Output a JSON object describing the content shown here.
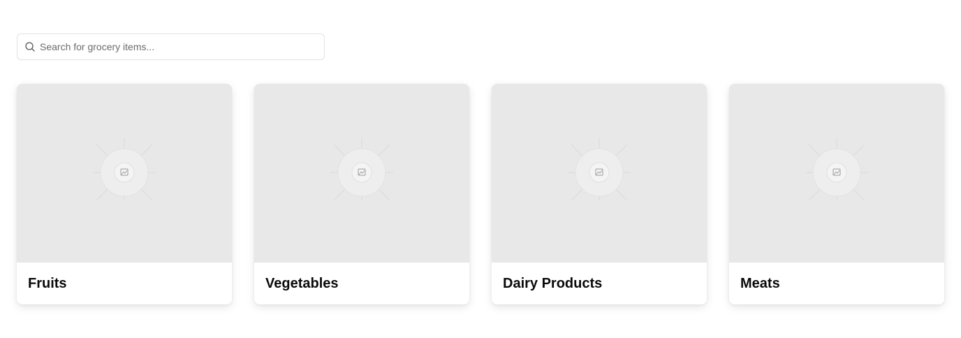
{
  "search": {
    "placeholder": "Search for grocery items..."
  },
  "categories": [
    {
      "title": "Fruits",
      "image_icon": "image-placeholder-icon"
    },
    {
      "title": "Vegetables",
      "image_icon": "image-placeholder-icon"
    },
    {
      "title": "Dairy Products",
      "image_icon": "image-placeholder-icon"
    },
    {
      "title": "Meats",
      "image_icon": "image-placeholder-icon"
    }
  ],
  "colors": {
    "image_placeholder_bg": "#e8e8e8",
    "card_bg": "#ffffff",
    "input_border": "#e2e2e5",
    "title_text": "#0a0a0a"
  }
}
